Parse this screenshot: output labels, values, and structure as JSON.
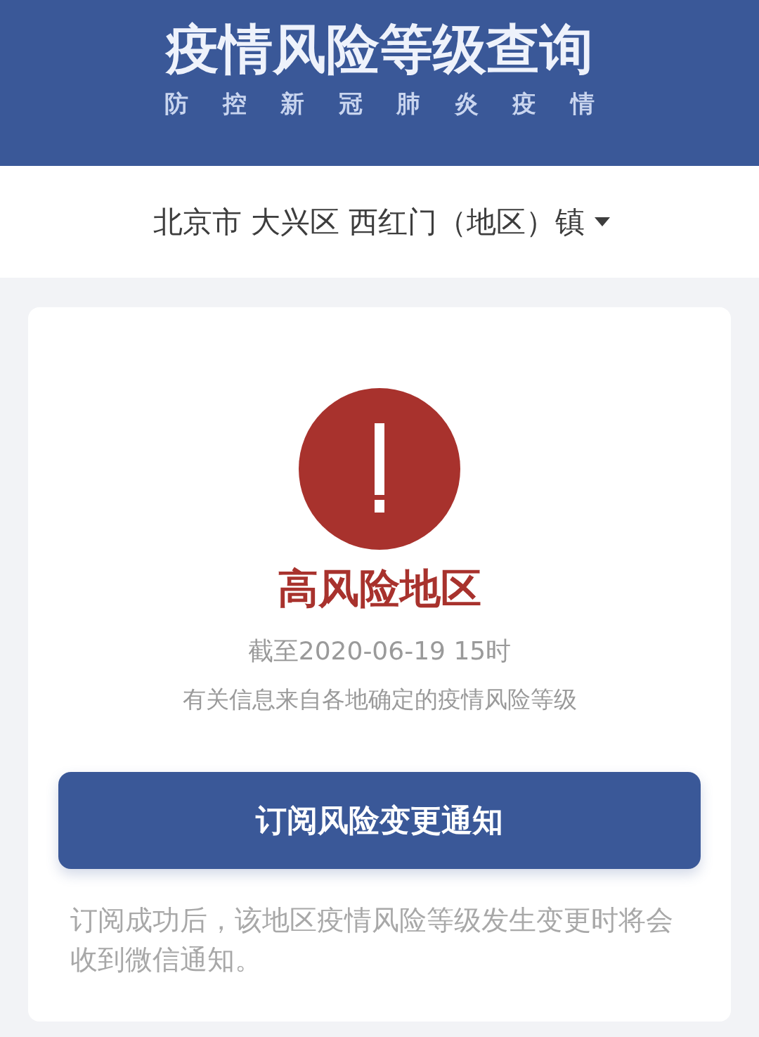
{
  "header": {
    "title": "疫情风险等级查询",
    "subtitle": "防 控 新 冠 肺 炎 疫 情"
  },
  "location_selector": {
    "value": "北京市 大兴区 西红门（地区）镇"
  },
  "risk_card": {
    "status": {
      "kind": "high",
      "label": "高风险地区"
    },
    "as_of": "截至2020-06-19 15时",
    "source_note": "有关信息来自各地确定的疫情风险等级",
    "subscribe_button": {
      "label": "订阅风险变更通知"
    },
    "footnote": "订阅成功后，该地区疫情风险等级发生变更时将会收到微信通知。"
  }
}
